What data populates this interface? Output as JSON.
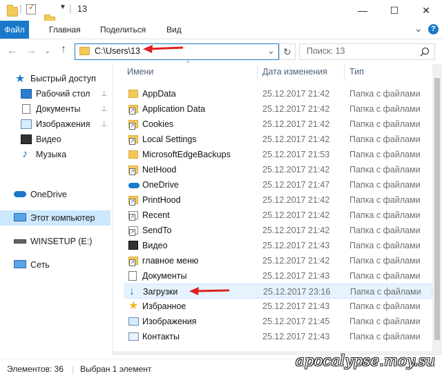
{
  "window": {
    "title": "13",
    "minimize": "—",
    "maximize": "☐",
    "close": "✕"
  },
  "ribbon": {
    "tabs": [
      "Файл",
      "Главная",
      "Поделиться",
      "Вид"
    ],
    "collapse": "⌄",
    "help": "?"
  },
  "nav": {
    "back": "←",
    "forward": "→",
    "history": "⌄",
    "up": "↑",
    "address": "C:\\Users\\13",
    "address_dropdown": "⌄",
    "refresh": "↻",
    "search_placeholder": "Поиск: 13",
    "search_icon": "search-icon"
  },
  "sidebar": {
    "items": [
      {
        "label": "Быстрый доступ",
        "icon": "star-icon",
        "pinned": false
      },
      {
        "label": "Рабочий стол",
        "icon": "desktop-icon",
        "pinned": true
      },
      {
        "label": "Документы",
        "icon": "documents-icon",
        "pinned": true
      },
      {
        "label": "Изображения",
        "icon": "pictures-icon",
        "pinned": true
      },
      {
        "label": "Видео",
        "icon": "video-icon",
        "pinned": false
      },
      {
        "label": "Музыка",
        "icon": "music-icon",
        "pinned": false
      },
      {
        "label": "OneDrive",
        "icon": "cloud-icon",
        "pinned": false
      },
      {
        "label": "Этот компьютер",
        "icon": "computer-icon",
        "pinned": false,
        "selected": true
      },
      {
        "label": "WINSETUP (E:)",
        "icon": "drive-icon",
        "pinned": false
      },
      {
        "label": "Сеть",
        "icon": "network-icon",
        "pinned": false
      }
    ],
    "pin_glyph": "📌"
  },
  "columns": {
    "name": "Имени",
    "date": "Дата изменения",
    "type": "Тип",
    "sort_glyph": "^"
  },
  "files": [
    {
      "name": "AppData",
      "date": "25.12.2017 21:42",
      "type": "Папка с файлами",
      "icon": "folder-icon"
    },
    {
      "name": "Application Data",
      "date": "25.12.2017 21:42",
      "type": "Папка с файлами",
      "icon": "folder-link-icon"
    },
    {
      "name": "Cookies",
      "date": "25.12.2017 21:42",
      "type": "Папка с файлами",
      "icon": "folder-link-icon"
    },
    {
      "name": "Local Settings",
      "date": "25.12.2017 21:42",
      "type": "Папка с файлами",
      "icon": "folder-link-icon"
    },
    {
      "name": "MicrosoftEdgeBackups",
      "date": "25.12.2017 21:53",
      "type": "Папка с файлами",
      "icon": "folder-icon"
    },
    {
      "name": "NetHood",
      "date": "25.12.2017 21:42",
      "type": "Папка с файлами",
      "icon": "folder-link-icon"
    },
    {
      "name": "OneDrive",
      "date": "25.12.2017 21:47",
      "type": "Папка с файлами",
      "icon": "cloud-icon"
    },
    {
      "name": "PrintHood",
      "date": "25.12.2017 21:42",
      "type": "Папка с файлами",
      "icon": "folder-link-icon"
    },
    {
      "name": "Recent",
      "date": "25.12.2017 21:42",
      "type": "Папка с файлами",
      "icon": "folder-link-icon"
    },
    {
      "name": "SendTo",
      "date": "25.12.2017 21:42",
      "type": "Папка с файлами",
      "icon": "folder-link-icon"
    },
    {
      "name": "Видео",
      "date": "25.12.2017 21:43",
      "type": "Папка с файлами",
      "icon": "video-icon"
    },
    {
      "name": "главное меню",
      "date": "25.12.2017 21:42",
      "type": "Папка с файлами",
      "icon": "folder-link-icon"
    },
    {
      "name": "Документы",
      "date": "25.12.2017 21:43",
      "type": "Папка с файлами",
      "icon": "documents-icon"
    },
    {
      "name": "Загрузки",
      "date": "25.12.2017 23:16",
      "type": "Папка с файлами",
      "icon": "download-icon",
      "selected": true
    },
    {
      "name": "Избранное",
      "date": "25.12.2017 21:43",
      "type": "Папка с файлами",
      "icon": "star-icon"
    },
    {
      "name": "Изображения",
      "date": "25.12.2017 21:45",
      "type": "Папка с файлами",
      "icon": "pictures-icon"
    },
    {
      "name": "Контакты",
      "date": "25.12.2017 21:43",
      "type": "Папка с файлами",
      "icon": "contacts-icon"
    }
  ],
  "status": {
    "count": "Элементов: 36",
    "selected": "Выбран 1 элемент"
  },
  "watermark": "apocalypse.moy.su",
  "colors": {
    "accent": "#1979ca",
    "selection": "#cce8ff",
    "annotation_arrow": "#e02020"
  }
}
